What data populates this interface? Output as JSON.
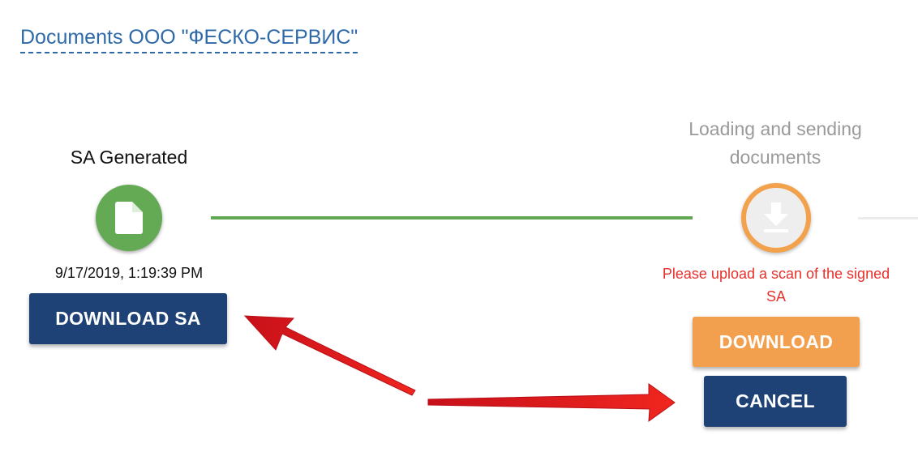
{
  "header": {
    "title": "Documents ООО \"ФЕСКО-СЕРВИС\""
  },
  "steps": [
    {
      "title": "SA Generated",
      "icon": "document-icon",
      "status": "done",
      "timestamp": "9/17/2019, 1:19:39 PM",
      "button_label": "DOWNLOAD SA"
    },
    {
      "title": "Loading and sending documents",
      "icon": "download-icon",
      "status": "active",
      "notice": "Please upload a scan of the signed SA",
      "download_label": "DOWNLOAD",
      "cancel_label": "CANCEL"
    }
  ],
  "colors": {
    "title_link": "#2e6aa8",
    "step_done": "#64a953",
    "step_active_ring": "#f2a14c",
    "primary_button": "#1e4276",
    "secondary_button": "#f2a04d",
    "notice_text": "#e8302b",
    "annotation_arrow": "#e8191b"
  }
}
